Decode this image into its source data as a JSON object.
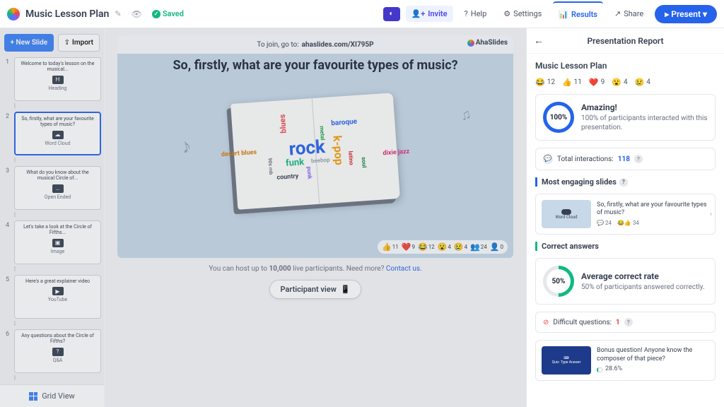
{
  "header": {
    "title": "Music Lesson Plan",
    "saved": "Saved",
    "invite": "Invite",
    "help": "Help",
    "settings": "Settings",
    "results": "Results",
    "share": "Share",
    "present": "Present"
  },
  "left": {
    "new_slide": "+ New Slide",
    "import": "Import",
    "grid_view": "Grid View",
    "slides": [
      {
        "n": "1",
        "title": "Welcome to today's lesson on the musical...",
        "type": "Heading"
      },
      {
        "n": "2",
        "title": "So, firstly, what are your favourite types of music?",
        "type": "Word Cloud"
      },
      {
        "n": "3",
        "title": "What do you know about the musical Circle of...",
        "type": "Open Ended"
      },
      {
        "n": "4",
        "title": "Let's take a look at the Circle of Fifths...",
        "type": "Image"
      },
      {
        "n": "5",
        "title": "Here's a great explainer video",
        "type": "YouTube"
      },
      {
        "n": "6",
        "title": "Any questions about the Circle of Fifths?",
        "type": "Q&A"
      }
    ]
  },
  "center": {
    "join_prefix": "To join, go to: ",
    "join_url": "ahaslides.com/XI795P",
    "brand": "AhaSlides",
    "question": "So, firstly, what are your favourite types of music?",
    "words": {
      "rock": "rock",
      "kpop": "k-pop",
      "funk": "funk",
      "blues": "blues",
      "baroque": "baroque",
      "metal": "metal",
      "desert": "desert blues",
      "beebop": "beebop",
      "country": "country",
      "punk": "punk",
      "rnb": "90s rnb",
      "latino": "latino",
      "soul": "soul",
      "dixie": "dixie jazz"
    },
    "reactions": {
      "like": "11",
      "heart": "9",
      "laugh": "12",
      "wow": "4",
      "sad": "4",
      "people": "24",
      "guest": "0"
    },
    "host_note_pre": "You can host up to ",
    "host_note_num": "10,000",
    "host_note_post": " live participants. Need more? ",
    "contact": "Contact us.",
    "participant_view": "Participant view"
  },
  "report": {
    "heading": "Presentation Report",
    "title": "Music Lesson Plan",
    "reactions": {
      "laugh": "12",
      "like": "11",
      "heart": "9",
      "wow": "4",
      "sad": "4"
    },
    "amazing_title": "Amazing!",
    "amazing_pct": "100%",
    "amazing_text": "100% of participants interacted with this presentation.",
    "total_interactions_label": "Total interactions: ",
    "total_interactions_val": "118",
    "engaging_head": "Most engaging slides",
    "engaging_slide_title": "So, firstly, what are your favourite types of music?",
    "engaging_slide_type": "Word Cloud",
    "engaging_comments": "24",
    "engaging_likes": "34",
    "correct_head": "Correct answers",
    "avg_pct": "50%",
    "avg_title": "Average correct rate",
    "avg_text": "50% of participants answered correctly.",
    "difficult_label": "Difficult questions: ",
    "difficult_val": "1",
    "difficult_slide_title": "Bonus question! Anyone know the composer of that piece?",
    "difficult_slide_type": "Quiz: Type Answer",
    "difficult_pct": "28.6%"
  }
}
